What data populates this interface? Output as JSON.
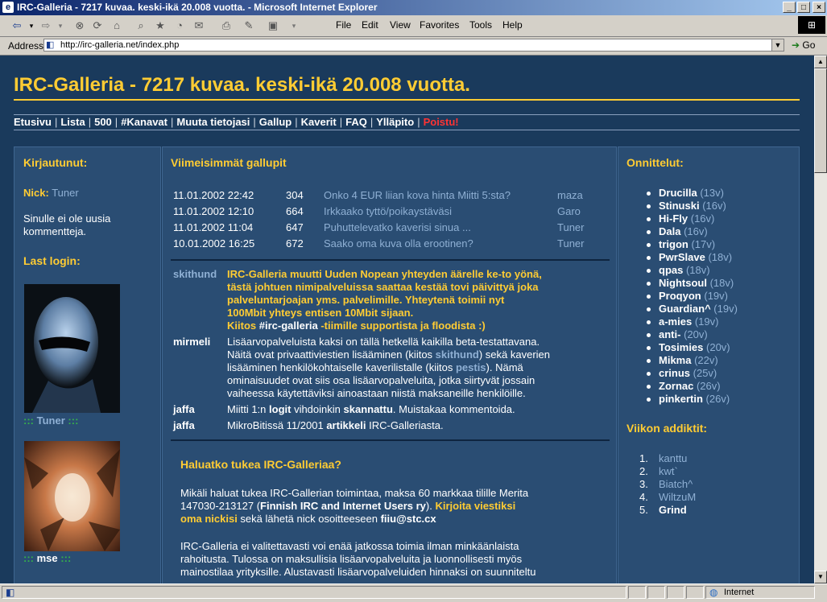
{
  "window": {
    "title": "IRC-Galleria - 7217 kuvaa. keski-ikä 20.008 vuotta. - Microsoft Internet Explorer",
    "min_btn": "_",
    "max_btn": "□",
    "close_btn": "×"
  },
  "toolbar": {
    "back": "⇦",
    "back_drop": "▾",
    "forward": "⇨",
    "forward_drop": "▾",
    "stop": "⊗",
    "refresh": "⟳",
    "home": "⌂",
    "search": "⌕",
    "favorites": "★",
    "history": "◔",
    "mail": "✉",
    "print": "⎙",
    "edit": "✎",
    "discuss": "▣",
    "discuss_drop": "▾",
    "menu_file": "File",
    "menu_edit": "Edit",
    "menu_view": "View",
    "menu_favorites": "Favorites",
    "menu_tools": "Tools",
    "menu_help": "Help"
  },
  "address": {
    "label": "Address",
    "url": "http://irc-galleria.net/index.php",
    "go": "Go"
  },
  "page": {
    "title": "IRC-Galleria - 7217 kuvaa. keski-ikä 20.008 vuotta.",
    "nav": [
      "Etusivu",
      "Lista",
      "500",
      "#Kanavat",
      "Muuta tietojasi",
      "Gallup",
      "Kaverit",
      "FAQ",
      "Ylläpito",
      "Poistu!"
    ],
    "nav_sep": "|",
    "left": {
      "logged_heading": "Kirjautunut:",
      "nick_label": "Nick:",
      "nick_value": "Tuner",
      "no_comments_1": "Sinulle ei ole uusia",
      "no_comments_2": "kommentteja.",
      "last_login_heading": "Last login:",
      "user1_prefix": ":::",
      "user1_name": "Tuner",
      "user1_suffix": ":::",
      "user2_prefix": ":::",
      "user2_name": "mse",
      "user2_suffix": ":::"
    },
    "middle": {
      "gallup_heading": "Viimeisimmät gallupit",
      "gallups": [
        {
          "date": "11.01.2002 22:42",
          "count": "304",
          "question": "Onko 4 EUR liian kova hinta Miitti 5:sta?",
          "user": "maza"
        },
        {
          "date": "11.01.2002 12:10",
          "count": "664",
          "question": "Irkkaako tyttö/poikaystäväsi",
          "user": "Garo"
        },
        {
          "date": "11.01.2002 11:04",
          "count": "647",
          "question": "Puhuttelevatko kaverisi sinua ...",
          "user": "Tuner"
        },
        {
          "date": "10.01.2002 16:25",
          "count": "672",
          "question": "Saako oma kuva olla erootinen?",
          "user": "Tuner"
        }
      ],
      "news": [
        {
          "name": "skithund",
          "l1": "IRC-Galleria muutti Uuden Nopean yhteyden äärelle ke-to yönä,",
          "l2": "tästä johtuen nimipalveluissa saattaa kestää tovi päivittyä joka",
          "l3": "palveluntarjoajan yms. palvelimille. Yhteytenä toimii nyt",
          "l4": "100Mbit yhteys entisen 10Mbit sijaan.",
          "l5a": "Kiitos ",
          "l5b": "#irc-galleria",
          "l5c": " -tiimille supportista ja floodista :)"
        },
        {
          "name": "mirmeli",
          "l1": "Lisäarvopalveluista kaksi on tällä hetkellä kaikilla beta-testattavana.",
          "l2a": "Näitä ovat privaattiviestien lisääminen (kiitos ",
          "l2b": "skithund",
          "l2c": ") sekä kaverien",
          "l3a": "lisääminen henkilökohtaiselle kaverilistalle (kiitos ",
          "l3b": "pestis",
          "l3c": "). Nämä",
          "l4": "ominaisuudet ovat siis osa lisäarvopalveluita, jotka siirtyvät jossain",
          "l5": "vaiheessa käytettäviksi ainoastaan niistä maksaneille henkilöille."
        },
        {
          "name": "jaffa",
          "a": "Miitti 1:n ",
          "b": "logit",
          "c": " vihdoinkin ",
          "d": "skannattu",
          "e": ". Muistakaa kommentoida."
        },
        {
          "name": "jaffa",
          "a": "MikroBitissä 11/2001 ",
          "b": "artikkeli",
          "c": " IRC-Galleriasta."
        }
      ],
      "support_heading": "Haluatko tukea IRC-Galleriaa?",
      "support_p1_l1": "Mikäli haluat tukea IRC-Gallerian toimintaa, maksa 60 markkaa tilille Merita",
      "support_p1_l2a": "147030-213127 (",
      "support_p1_l2b": "Finnish IRC and Internet Users ry",
      "support_p1_l2c": "). ",
      "support_p1_l2d": "Kirjoita viestiksi",
      "support_p1_l3a": "oma nickisi",
      "support_p1_l3b": " sekä lähetä nick osoitteeseen ",
      "support_p1_l3c": "fiiu@stc.cx",
      "support_p2_l1": "IRC-Galleria ei valitettavasti voi enää jatkossa toimia ilman minkäänlaista",
      "support_p2_l2": "rahoitusta. Tulossa on maksullisia lisäarvopalveluita ja luonnollisesti myös",
      "support_p2_l3": "mainostilaa yrityksille. Alustavasti lisäarvopalveluiden hinnaksi on suunniteltu"
    },
    "right": {
      "birthday_heading": "Onnittelut:",
      "birthdays": [
        {
          "name": "Drucilla",
          "age": "(13v)"
        },
        {
          "name": "Stinuski",
          "age": "(16v)"
        },
        {
          "name": "Hi-Fly",
          "age": "(16v)"
        },
        {
          "name": "Dala",
          "age": "(16v)"
        },
        {
          "name": "trigon",
          "age": "(17v)"
        },
        {
          "name": "PwrSlave",
          "age": "(18v)"
        },
        {
          "name": "qpas",
          "age": "(18v)"
        },
        {
          "name": "Nightsoul",
          "age": "(18v)"
        },
        {
          "name": "Proqyon",
          "age": "(19v)"
        },
        {
          "name": "Guardian^",
          "age": "(19v)"
        },
        {
          "name": "a-mies",
          "age": "(19v)"
        },
        {
          "name": "anti-",
          "age": "(20v)"
        },
        {
          "name": "Tosimies",
          "age": "(20v)"
        },
        {
          "name": "Mikma",
          "age": "(22v)"
        },
        {
          "name": "crinus",
          "age": "(25v)"
        },
        {
          "name": "Zornac",
          "age": "(26v)"
        },
        {
          "name": "pinkertin",
          "age": "(26v)"
        }
      ],
      "addicts_heading": "Viikon addiktit:",
      "addicts": [
        {
          "num": "1.",
          "name": "kanttu"
        },
        {
          "num": "2.",
          "name": "kwt`"
        },
        {
          "num": "3.",
          "name": "Biatch^"
        },
        {
          "num": "4.",
          "name": "WiltzuM"
        },
        {
          "num": "5.",
          "name": "Grind"
        }
      ]
    }
  },
  "status": {
    "zone": "Internet",
    "page_icon": "◧",
    "zone_icon": "◍"
  },
  "scrollbar": {
    "up": "▲",
    "down": "▼"
  }
}
